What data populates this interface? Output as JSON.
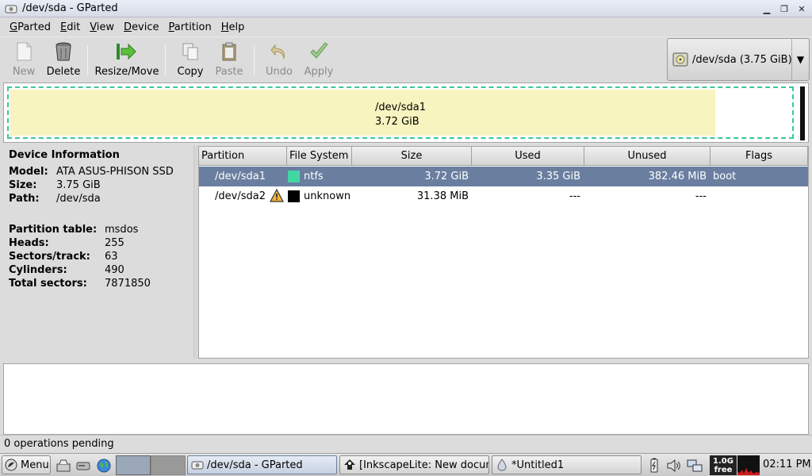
{
  "window": {
    "title": "/dev/sda - GParted"
  },
  "menubar": [
    {
      "label": "GParted",
      "mnemonic": "G",
      "rest": "Parted"
    },
    {
      "label": "Edit",
      "mnemonic": "E",
      "rest": "dit"
    },
    {
      "label": "View",
      "mnemonic": "V",
      "rest": "iew"
    },
    {
      "label": "Device",
      "mnemonic": "D",
      "rest": "evice"
    },
    {
      "label": "Partition",
      "mnemonic": "P",
      "rest": "artition"
    },
    {
      "label": "Help",
      "mnemonic": "H",
      "rest": "elp"
    }
  ],
  "toolbar": {
    "new_label": "New",
    "delete_label": "Delete",
    "resize_label": "Resize/Move",
    "copy_label": "Copy",
    "paste_label": "Paste",
    "undo_label": "Undo",
    "apply_label": "Apply"
  },
  "device_selector": {
    "value": "/dev/sda  (3.75 GiB)"
  },
  "graph": {
    "partition_name": "/dev/sda1",
    "partition_size": "3.72 GiB",
    "used_fraction": 0.9
  },
  "device_info": {
    "heading": "Device Information",
    "model_key": "Model:",
    "model": "ATA ASUS-PHISON SSD",
    "size_key": "Size:",
    "size": "3.75 GiB",
    "path_key": "Path:",
    "path": "/dev/sda",
    "ptable_key": "Partition table:",
    "ptable": "msdos",
    "heads_key": "Heads:",
    "heads": "255",
    "sectors_key": "Sectors/track:",
    "sectors": "63",
    "cylinders_key": "Cylinders:",
    "cylinders": "490",
    "total_key": "Total sectors:",
    "total": "7871850"
  },
  "table": {
    "headers": [
      "Partition",
      "File System",
      "Size",
      "Used",
      "Unused",
      "Flags"
    ],
    "rows": [
      {
        "partition": "/dev/sda1",
        "fs": "ntfs",
        "fs_color": "#42d6a4",
        "size": "3.72 GiB",
        "used": "3.35 GiB",
        "unused": "382.46 MiB",
        "flags": "boot"
      },
      {
        "partition": "/dev/sda2",
        "fs": "unknown",
        "fs_color": "#000000",
        "size": "31.38 MiB",
        "used": "---",
        "unused": "---",
        "flags": ""
      }
    ]
  },
  "status": {
    "text": "0 operations pending"
  },
  "taskbar": {
    "start_label": "Menu",
    "tasks": [
      "/dev/sda - GParted",
      "[InkscapeLite: New docum",
      "*Untitled1"
    ],
    "mem_top": "1.0G",
    "mem_bottom": "free",
    "clock": "02:11 PM"
  },
  "colors": {
    "selection": "#6a7ea0",
    "graph_fill": "#f8f4bf",
    "graph_border": "#3cc79a"
  }
}
